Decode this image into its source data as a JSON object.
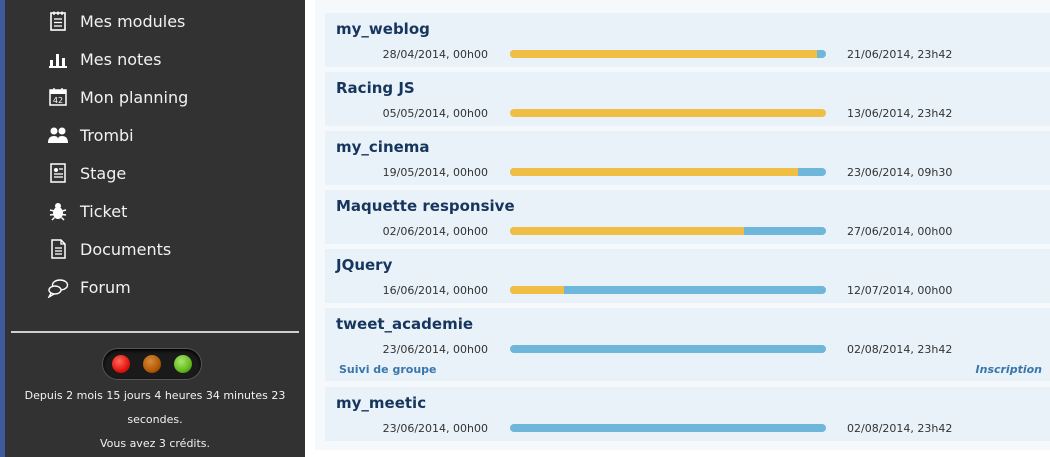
{
  "sidebar": {
    "items": [
      {
        "label": "Mes modules",
        "icon": "notepad-icon"
      },
      {
        "label": "Mes notes",
        "icon": "bar-chart-icon"
      },
      {
        "label": "Mon planning",
        "icon": "calendar-icon"
      },
      {
        "label": "Trombi",
        "icon": "users-icon"
      },
      {
        "label": "Stage",
        "icon": "id-card-icon"
      },
      {
        "label": "Ticket",
        "icon": "bug-icon"
      },
      {
        "label": "Documents",
        "icon": "document-icon"
      },
      {
        "label": "Forum",
        "icon": "chat-icon"
      }
    ],
    "traffic_light": {
      "red": "#e3140f",
      "orange": "#b25a06",
      "green": "#66b91f"
    },
    "status_line1": "Depuis 2 mois 15 jours 4 heures 34 minutes 23",
    "status_line2": "secondes.",
    "credits": "Vous avez 3 crédits."
  },
  "projects": [
    {
      "title": "my_weblog",
      "start": "28/04/2014, 00h00",
      "end": "21/06/2014, 23h42",
      "progress": 0.97
    },
    {
      "title": "Racing JS",
      "start": "05/05/2014, 00h00",
      "end": "13/06/2014, 23h42",
      "progress": 1.0
    },
    {
      "title": "my_cinema",
      "start": "19/05/2014, 00h00",
      "end": "23/06/2014, 09h30",
      "progress": 0.91
    },
    {
      "title": "Maquette responsive",
      "start": "02/06/2014, 00h00",
      "end": "27/06/2014, 00h00",
      "progress": 0.74
    },
    {
      "title": "JQuery",
      "start": "16/06/2014, 00h00",
      "end": "12/07/2014, 00h00",
      "progress": 0.17
    },
    {
      "title": "tweet_academie",
      "start": "23/06/2014, 00h00",
      "end": "02/08/2014, 23h42",
      "progress": 0.0,
      "link_left": "Suivi de groupe",
      "link_right": "Inscription"
    },
    {
      "title": "my_meetic",
      "start": "23/06/2014, 00h00",
      "end": "02/08/2014, 23h42",
      "progress": 0.0
    }
  ],
  "colors": {
    "bar_done": "#f0bd45",
    "bar_remaining": "#6fb6db",
    "title": "#17365d"
  }
}
